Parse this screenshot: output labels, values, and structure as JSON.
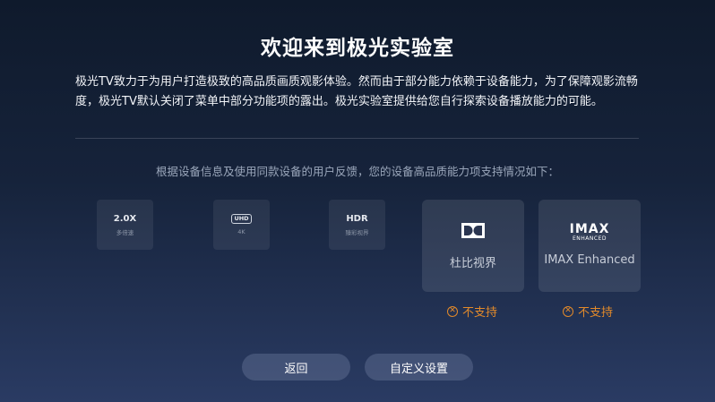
{
  "title": "欢迎来到极光实验室",
  "intro": "极光TV致力于为用户打造极致的高品质画质观影体验。然而由于部分能力依赖于设备能力，为了保障观影流畅度，极光TV默认关闭了菜单中部分功能项的露出。极光实验室提供给您自行探索设备播放能力的可能。",
  "subtitle": "根据设备信息及使用同款设备的用户反馈，您的设备高品质能力项支持情况如下：",
  "mini_features": [
    {
      "badge": "2.0X",
      "label": "多倍速"
    },
    {
      "badge": "UHD",
      "label": "4K"
    },
    {
      "badge": "HDR",
      "label": "臻彩视界"
    }
  ],
  "cards": [
    {
      "name": "杜比视界",
      "icon": "dolby-vision-icon",
      "status": "不支持"
    },
    {
      "name": "IMAX Enhanced",
      "icon": "imax-enhanced-icon",
      "logo_top": "IMAX",
      "logo_bottom": "ENHANCED",
      "status": "不支持"
    }
  ],
  "status_color": "#e38a2a",
  "buttons": {
    "back": "返回",
    "custom": "自定义设置"
  }
}
